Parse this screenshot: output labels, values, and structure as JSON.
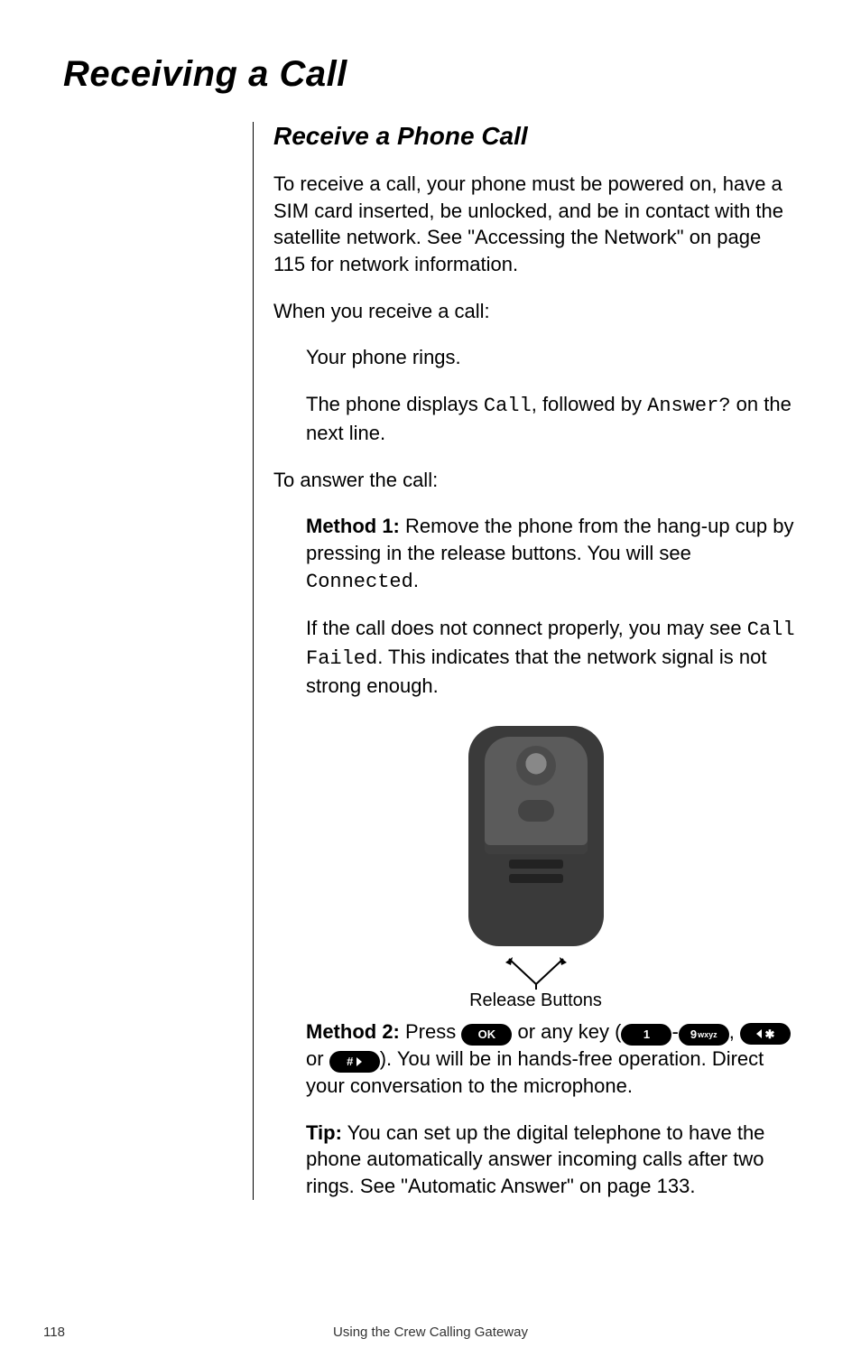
{
  "title": "Receiving a Call",
  "subtitle": "Receive a Phone Call",
  "intro": "To receive a call, your phone must be powered on, have a SIM card inserted, be unlocked, and be in contact with the satellite network. See \"Accessing the Network\" on page 115 for network information.",
  "when_label": "When you receive a call:",
  "bullets_a": [
    "Your phone rings."
  ],
  "bullet_display_pre": "The phone displays ",
  "display_call": "Call",
  "bullet_display_mid": ", followed by ",
  "display_answer": "Answer?",
  "bullet_display_post": " on the next line.",
  "answer_label": "To answer the call:",
  "method1_label": "Method 1:",
  "method1_pre": " Remove the phone from the hang-up cup by pressing in the release buttons. You will see ",
  "display_connected": "Connected",
  "period": ".",
  "fail_pre": "If the call does not connect properly, you may see ",
  "display_fail": "Call Failed",
  "fail_post": ". This indicates that the network signal is not strong enough.",
  "caption": "Release Buttons",
  "method2_label": "Method 2:",
  "m2_pre": " Press ",
  "or": " or ",
  "any_key": " any key ",
  "dash": "-",
  "comma": ", ",
  "paren_open": "(",
  "paren_close": ")",
  "m2_post": ". You will be in hands-free operation. Direct your conversation to the microphone.",
  "tip_label": "Tip:",
  "tip_pre": " You can set up the digital telephone to have the phone automatically answer incoming calls after two rings. See \"Automatic Answer\" on page 133.",
  "icons": {
    "ok": "OK",
    "one": "1",
    "nine": "9",
    "nine_sub": "wxyz",
    "star": "✱",
    "hash": "#"
  },
  "footer": {
    "page": "118",
    "label": "Using the Crew Calling Gateway"
  }
}
